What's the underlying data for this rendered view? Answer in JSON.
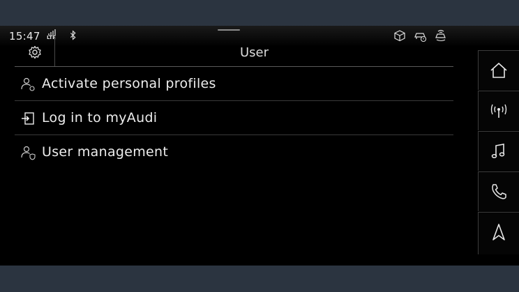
{
  "status": {
    "time": "15:47",
    "lte": "LTE",
    "icons": [
      "lte-signal-icon",
      "bluetooth-icon",
      "box-icon",
      "car-service-icon",
      "car-connect-icon"
    ]
  },
  "header": {
    "title": "User",
    "settings_icon": "gear-icon"
  },
  "menu": [
    {
      "label": "Activate personal profiles",
      "icon": "user-profile-icon"
    },
    {
      "label": "Log in to myAudi",
      "icon": "login-icon"
    },
    {
      "label": "User management",
      "icon": "user-shield-icon"
    }
  ],
  "rail": [
    "home-icon",
    "radio-icon",
    "music-icon",
    "phone-icon",
    "navigation-icon"
  ],
  "colors": {
    "background": "#000000",
    "text": "#ededed",
    "frame": "#2b3440"
  }
}
